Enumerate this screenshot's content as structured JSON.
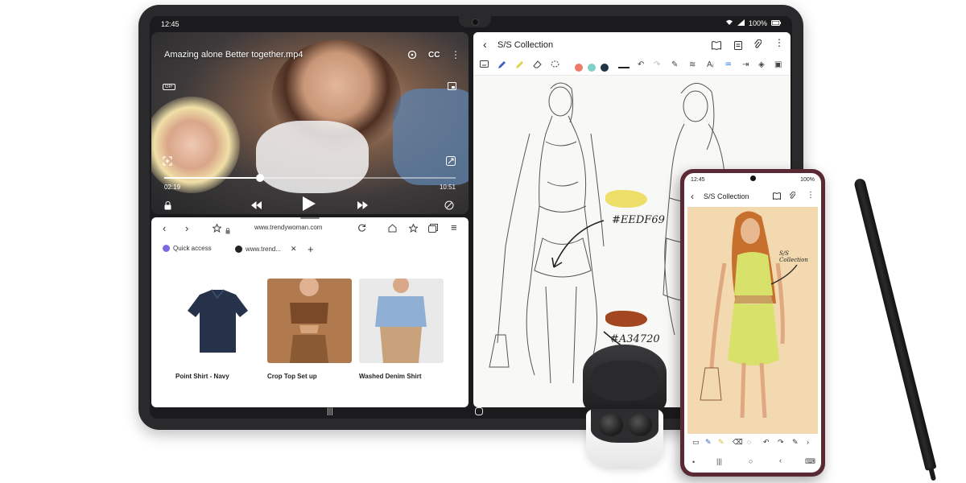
{
  "tablet": {
    "status": {
      "time": "12:45",
      "battery": "100%"
    },
    "video": {
      "title": "Amazing alone Better together.mp4",
      "cc_label": "CC",
      "gif_label": "GIF",
      "elapsed": "02:19",
      "duration": "10:51",
      "progress": 0.33
    },
    "browser": {
      "url": "www.trendywoman.com",
      "tabs": [
        {
          "label": "Quick access"
        },
        {
          "label": "www.trend..."
        }
      ],
      "products": [
        {
          "name": "Point Shirt - Navy"
        },
        {
          "name": "Crop Top Set up"
        },
        {
          "name": "Washed Denim Shirt"
        }
      ]
    },
    "notes": {
      "title": "S/S Collection",
      "colors": [
        "#f07a6a",
        "#7fd0c8",
        "#1f3545"
      ],
      "annotations": [
        {
          "text": "#EEDF69",
          "color": "#EEDF69"
        },
        {
          "text": "#A34720",
          "color": "#A34720"
        }
      ]
    }
  },
  "phone": {
    "status": {
      "time": "12:45",
      "battery": "100%"
    },
    "title": "S/S Collection",
    "annotation": "S/S Collection"
  },
  "colors": {
    "accent": "#1a73e8",
    "tablet_body": "#2a2a2c",
    "phone_body": "#5a2a34"
  }
}
